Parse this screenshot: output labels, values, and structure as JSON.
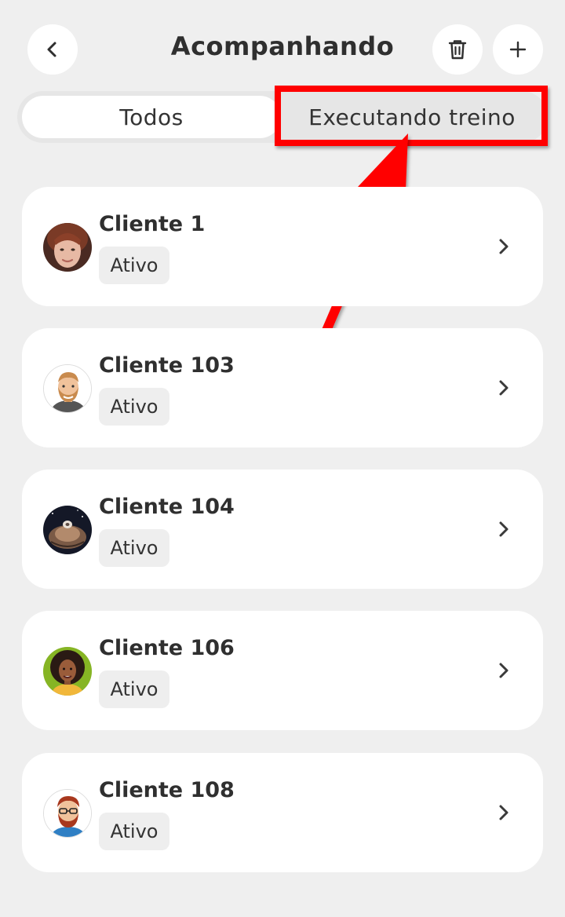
{
  "header": {
    "title": "Acompanhando",
    "back_icon": "chevron-left-icon",
    "delete_icon": "trash-icon",
    "add_icon": "plus-icon"
  },
  "tabs": [
    {
      "label": "Todos",
      "selected": true
    },
    {
      "label": "Executando treino",
      "selected": false
    }
  ],
  "annotation": {
    "highlight_color": "#ff0000",
    "arrow_color": "#ff0000"
  },
  "clients": [
    {
      "name": "Cliente 1",
      "status": "Ativo",
      "avatar": "woman-photo-avatar"
    },
    {
      "name": "Cliente 103",
      "status": "Ativo",
      "avatar": "bearded-man-cartoon-avatar"
    },
    {
      "name": "Cliente 104",
      "status": "Ativo",
      "avatar": "space-planet-avatar"
    },
    {
      "name": "Cliente 106",
      "status": "Ativo",
      "avatar": "woman-cartoon-avatar"
    },
    {
      "name": "Cliente 108",
      "status": "Ativo",
      "avatar": "man-glasses-cartoon-avatar"
    }
  ],
  "colors": {
    "background": "#efefef",
    "card": "#ffffff",
    "text": "#2f2f2f",
    "badge": "#eeeeee"
  }
}
